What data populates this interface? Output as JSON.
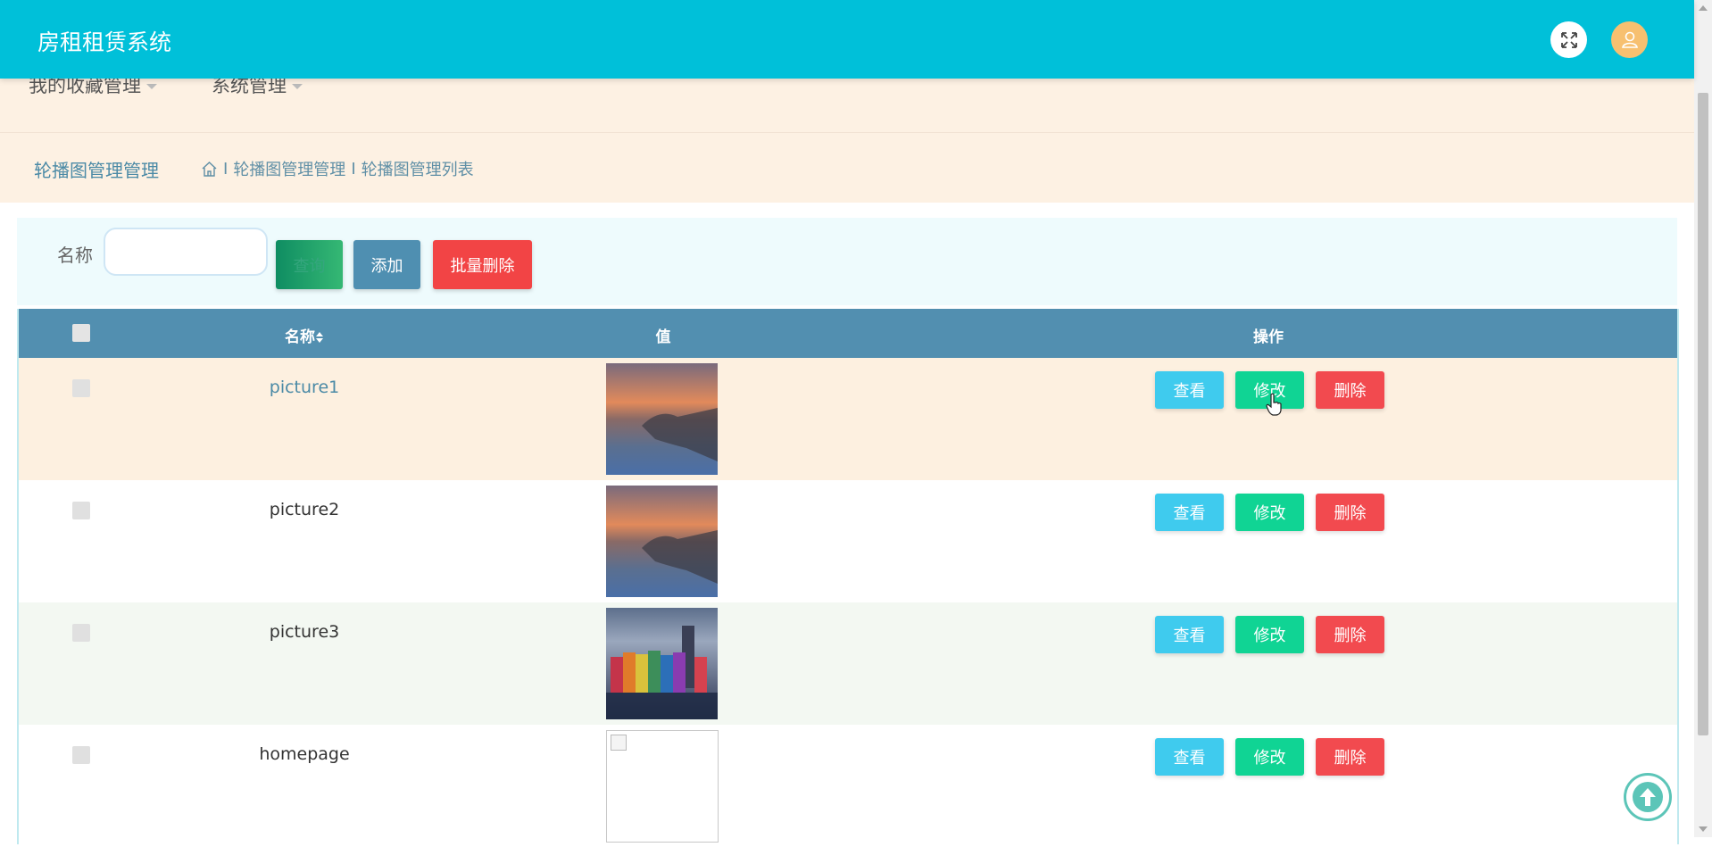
{
  "header": {
    "title": "房租租赁系统",
    "icons": [
      "expand-icon",
      "user-icon"
    ]
  },
  "nav": {
    "items": [
      {
        "label": "我的收藏管理"
      },
      {
        "label": "系统管理"
      }
    ]
  },
  "breadcrumb": {
    "page_title": "轮播图管理管理",
    "home_icon": "home-icon",
    "items": [
      "轮播图管理管理",
      "轮播图管理列表"
    ],
    "separator": "I"
  },
  "search": {
    "label": "名称",
    "value": "",
    "query_label": "查询",
    "add_label": "添加",
    "batch_delete_label": "批量删除"
  },
  "table": {
    "columns": {
      "name": "名称",
      "sort_icon": "sort-icon",
      "value": "值",
      "actions": "操作"
    },
    "rows": [
      {
        "name": "picture1",
        "image": "sunset-lake",
        "highlight": true
      },
      {
        "name": "picture2",
        "image": "sunset-lake",
        "highlight": false
      },
      {
        "name": "picture3",
        "image": "colorful-houses",
        "highlight": false
      },
      {
        "name": "homepage",
        "image": "broken-image",
        "highlight": false
      }
    ],
    "actions": {
      "view": "查看",
      "edit": "修改",
      "delete": "删除"
    }
  },
  "colors": {
    "header": "#00c0d9",
    "nav_bg": "#fdf1e3",
    "table_header": "#528fb0",
    "row_highlight": "#fdf0e0",
    "row_alt": "#f3f8f2",
    "view_button": "#3fcbee",
    "edit_button": "#10d494",
    "delete_button": "#f24a4f"
  }
}
